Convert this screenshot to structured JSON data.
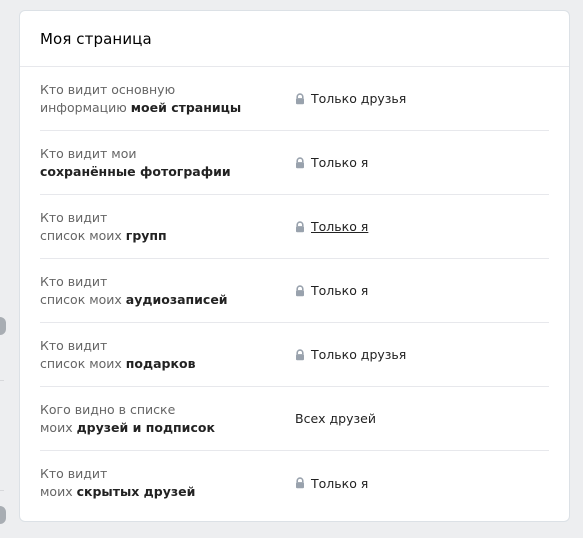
{
  "card": {
    "title": "Моя страница"
  },
  "rows": [
    {
      "label_line1": "Кто видит основную",
      "label_line2_plain": "информацию ",
      "label_line2_bold": "моей страницы",
      "value": "Только друзья",
      "locked": true
    },
    {
      "label_line1": "Кто видит мои",
      "label_line2_plain": "",
      "label_line2_bold": "сохранённые фотографии",
      "value": "Только я",
      "locked": true
    },
    {
      "label_line1": "Кто видит",
      "label_line2_plain": "список моих ",
      "label_line2_bold": "групп",
      "value": "Только я",
      "locked": true,
      "underlined": true
    },
    {
      "label_line1": "Кто видит",
      "label_line2_plain": "список моих ",
      "label_line2_bold": "аудиозаписей",
      "value": "Только я",
      "locked": true
    },
    {
      "label_line1": "Кто видит",
      "label_line2_plain": "список моих ",
      "label_line2_bold": "подарков",
      "value": "Только друзья",
      "locked": true
    },
    {
      "label_line1": "Кого видно в списке",
      "label_line2_plain": "моих ",
      "label_line2_bold": "друзей и подписок",
      "value": "Всех друзей",
      "locked": false
    },
    {
      "label_line1": "Кто видит",
      "label_line2_plain": "моих ",
      "label_line2_bold": "скрытых друзей",
      "value": "Только я",
      "locked": true
    }
  ],
  "icons": {
    "lock": "lock-icon"
  },
  "colors": {
    "lock": "#99a2ad",
    "label": "#656565",
    "value": "#222222"
  }
}
